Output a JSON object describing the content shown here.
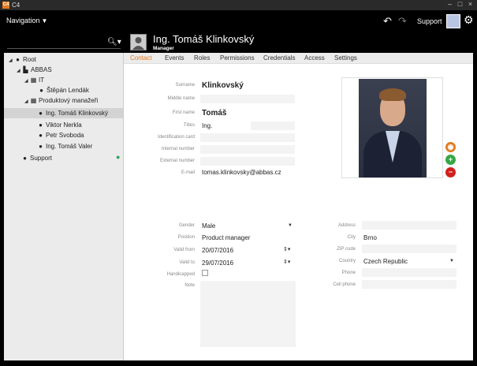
{
  "window": {
    "logo": "C4",
    "title": "C4"
  },
  "topbar": {
    "nav_label": "Navigation",
    "support_label": "Support"
  },
  "header": {
    "name": "Ing. Tomáš Klinkovský",
    "role": "Manager"
  },
  "tree": [
    {
      "label": "Root",
      "icon": "globe-icon"
    },
    {
      "label": "ABBAS",
      "icon": "building-icon"
    },
    {
      "label": "IT",
      "icon": "grid-icon"
    },
    {
      "label": "Štěpán Lendák",
      "icon": "user-icon"
    },
    {
      "label": "Produktový manažeři",
      "icon": "grid-icon"
    },
    {
      "label": "Ing. Tomáš Klinkovský",
      "icon": "user-icon"
    },
    {
      "label": "Viktor Nerkla",
      "icon": "user-icon"
    },
    {
      "label": "Petr Svoboda",
      "icon": "user-icon"
    },
    {
      "label": "Ing. Tomáš Valer",
      "icon": "user-icon"
    },
    {
      "label": "Support",
      "icon": "user-icon"
    }
  ],
  "tabs": [
    "Contact",
    "Events",
    "Roles",
    "Permissions",
    "Credentials",
    "Access",
    "Settings"
  ],
  "contact": {
    "surname_label": "Surname",
    "surname": "Klinkovský",
    "middle_label": "Middle name",
    "middle": "",
    "first_label": "First name",
    "first": "Tomáš",
    "titles_label": "Titles",
    "titles": "Ing.",
    "titles_after": "",
    "idcard_label": "Identification card",
    "idcard": "",
    "internal_label": "Internal number",
    "internal": "",
    "external_label": "External number",
    "external": "",
    "email_label": "E-mail",
    "email": "tomas.klinkovsky@abbas.cz"
  },
  "details": {
    "gender_label": "Gender",
    "gender": "Male",
    "position_label": "Position",
    "position": "Product manager",
    "valid_from_label": "Valid from",
    "valid_from": "20/07/2016",
    "valid_to_label": "Valid to",
    "valid_to": "29/07/2016",
    "handicapped_label": "Handicapped",
    "note_label": "Note"
  },
  "address": {
    "address_label": "Address",
    "address": "",
    "city_label": "City",
    "city": "Brno",
    "zip_label": "ZIP code",
    "zip": "",
    "country_label": "Country",
    "country": "Czech Republic",
    "phone_label": "Phone",
    "phone": "",
    "cell_label": "Cell phone",
    "cell": ""
  },
  "colors": {
    "accent": "#e07b20",
    "add": "#35a845",
    "remove": "#d0201c"
  }
}
